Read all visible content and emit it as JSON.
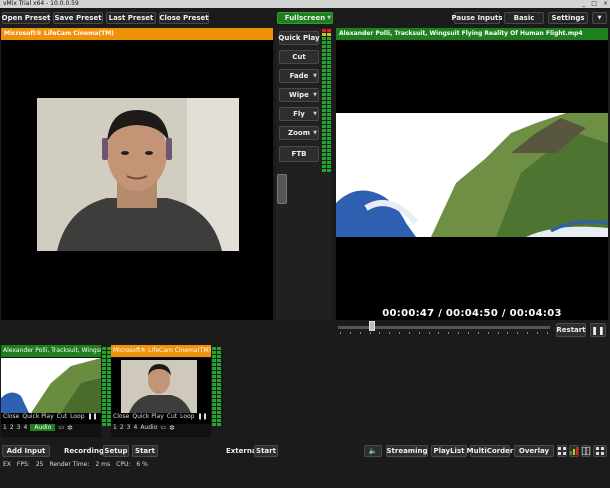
{
  "window": {
    "title": "vMix Trial x64 - 10.0.0.59",
    "controls": [
      "_",
      "□",
      "×"
    ]
  },
  "top_toolbar": {
    "open_preset": "Open Preset",
    "save_preset": "Save Preset",
    "last_preset": "Last Preset",
    "close_preset": "Close Preset",
    "fullscreen": "Fullscreen",
    "pause_inputs": "Pause Inputs",
    "basic": "Basic",
    "settings": "Settings"
  },
  "preview": {
    "title": "Microsoft® LifeCam Cinema(TM)"
  },
  "output": {
    "title": "Alexander Polli, Tracksuit, Wingsuit Flying Reality Of Human Flight.mp4",
    "timecode": "00:00:47  /  00:04:50  /  00:04:03",
    "restart": "Restart",
    "pause_icon": "pause-icon",
    "progress": 0.16
  },
  "transitions": {
    "quick_play": "Quick Play",
    "cut": "Cut",
    "fade": "Fade",
    "wipe": "Wipe",
    "fly": "Fly",
    "zoom": "Zoom",
    "ftb": "FTB"
  },
  "inputs": [
    {
      "title": "Alexander Polli, Tracksuit, Wingsuit",
      "header_color": "#1e7f1e",
      "ctrl_close": "Close",
      "ctrl_quickplay": "Quick Play",
      "ctrl_cut": "Cut",
      "ctrl_loop": "Loop",
      "n1": "1",
      "n2": "2",
      "n3": "3",
      "n4": "4",
      "audio": "Audio"
    },
    {
      "title": "Microsoft® LifeCam Cinema(TM)",
      "header_color": "#f0910a",
      "ctrl_close": "Close",
      "ctrl_quickplay": "Quick Play",
      "ctrl_cut": "Cut",
      "ctrl_loop": "Loop",
      "n1": "1",
      "n2": "2",
      "n3": "3",
      "n4": "4",
      "audio": "Audio"
    }
  ],
  "bottom_bar": {
    "add_input": "Add Input",
    "recording": "Recording",
    "setup": "Setup",
    "start": "Start",
    "external": "External",
    "start2": "Start",
    "streaming": "Streaming",
    "playlist": "PlayList",
    "multicorder": "MultiCorder",
    "overlay": "Overlay"
  },
  "status": {
    "ex": "EX",
    "fps_label": "FPS:",
    "fps": "25",
    "render_label": "Render Time:",
    "render": "2 ms",
    "cpu_label": "CPU:",
    "cpu": "6 %"
  },
  "colors": {
    "preview_accent": "#f0910a",
    "output_accent": "#1e7f1e",
    "fullscreen_accent": "#1e7f1e"
  }
}
